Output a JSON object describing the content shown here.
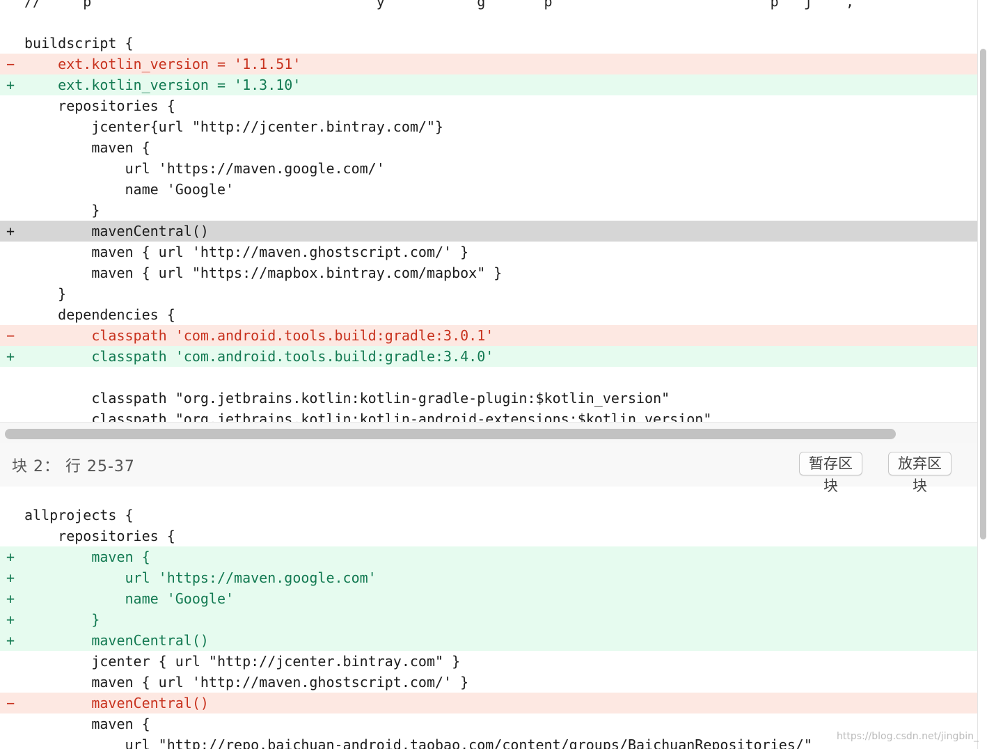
{
  "colors": {
    "removed_bg": "#fde8e2",
    "removed_text": "#c8321e",
    "added_bg": "#e6fbef",
    "added_text": "#137a52",
    "selected_bg": "#d6d6d6"
  },
  "hunk1": {
    "cut_line": "//     p                                  y           g       p                          p   j    ,  ",
    "lines": [
      {
        "type": "context",
        "marker": "",
        "text": ""
      },
      {
        "type": "context",
        "marker": "",
        "text": "buildscript {"
      },
      {
        "type": "removed",
        "marker": "−",
        "text": "    ext.kotlin_version = '1.1.51'"
      },
      {
        "type": "added",
        "marker": "+",
        "text": "    ext.kotlin_version = '1.3.10'"
      },
      {
        "type": "context",
        "marker": "",
        "text": "    repositories {"
      },
      {
        "type": "context",
        "marker": "",
        "text": "        jcenter{url \"http://jcenter.bintray.com/\"}"
      },
      {
        "type": "context",
        "marker": "",
        "text": "        maven {"
      },
      {
        "type": "context",
        "marker": "",
        "text": "            url 'https://maven.google.com/'"
      },
      {
        "type": "context",
        "marker": "",
        "text": "            name 'Google'"
      },
      {
        "type": "context",
        "marker": "",
        "text": "        }"
      },
      {
        "type": "selected",
        "marker": "+",
        "text": "        mavenCentral()"
      },
      {
        "type": "context",
        "marker": "",
        "text": "        maven { url 'http://maven.ghostscript.com/' }"
      },
      {
        "type": "context",
        "marker": "",
        "text": "        maven { url \"https://mapbox.bintray.com/mapbox\" }"
      },
      {
        "type": "context",
        "marker": "",
        "text": "    }"
      },
      {
        "type": "context",
        "marker": "",
        "text": "    dependencies {"
      },
      {
        "type": "removed",
        "marker": "−",
        "text": "        classpath 'com.android.tools.build:gradle:3.0.1'"
      },
      {
        "type": "added",
        "marker": "+",
        "text": "        classpath 'com.android.tools.build:gradle:3.4.0'"
      },
      {
        "type": "context",
        "marker": "",
        "text": ""
      },
      {
        "type": "context",
        "marker": "",
        "text": "        classpath \"org.jetbrains.kotlin:kotlin-gradle-plugin:$kotlin_version\""
      },
      {
        "type": "context",
        "marker": "",
        "text": "        classpath \"org.jetbrains.kotlin:kotlin-android-extensions:$kotlin_version\""
      }
    ]
  },
  "hunk_header": {
    "title": "块 2： 行 25-37",
    "stage_label": "暂存区块",
    "discard_label": "放弃区块"
  },
  "hunk2": {
    "lines": [
      {
        "type": "context",
        "marker": "",
        "text": "allprojects {"
      },
      {
        "type": "context",
        "marker": "",
        "text": "    repositories {"
      },
      {
        "type": "added",
        "marker": "+",
        "text": "        maven {"
      },
      {
        "type": "added",
        "marker": "+",
        "text": "            url 'https://maven.google.com'"
      },
      {
        "type": "added",
        "marker": "+",
        "text": "            name 'Google'"
      },
      {
        "type": "added",
        "marker": "+",
        "text": "        }"
      },
      {
        "type": "added",
        "marker": "+",
        "text": "        mavenCentral()"
      },
      {
        "type": "context",
        "marker": "",
        "text": "        jcenter { url \"http://jcenter.bintray.com\" }"
      },
      {
        "type": "context",
        "marker": "",
        "text": "        maven { url 'http://maven.ghostscript.com/' }"
      },
      {
        "type": "removed",
        "marker": "−",
        "text": "        mavenCentral()"
      },
      {
        "type": "context",
        "marker": "",
        "text": "        maven {"
      },
      {
        "type": "context",
        "marker": "",
        "text": "            url \"http://repo.baichuan-android.taobao.com/content/groups/BaichuanRepositories/\""
      }
    ]
  },
  "watermark": "https://blog.csdn.net/jingbin_"
}
